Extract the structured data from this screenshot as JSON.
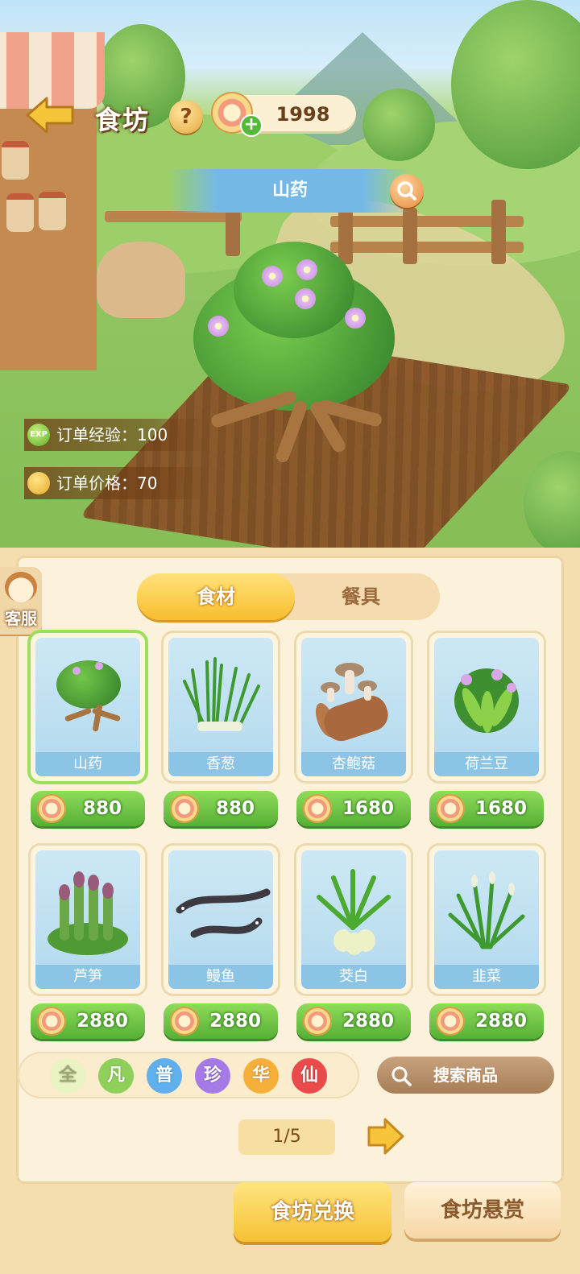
{
  "header": {
    "title": "食坊",
    "help_label": "?",
    "coins": "1998",
    "coin_plus": "+"
  },
  "selected_item": {
    "name": "山药",
    "order_exp_label": "订单经验：100",
    "order_price_label": "订单价格：70",
    "exp_icon_text": "EXP"
  },
  "service": {
    "label": "客服"
  },
  "tabs": [
    {
      "label": "食材",
      "active": true
    },
    {
      "label": "餐具",
      "active": false
    }
  ],
  "items": [
    {
      "name": "山药",
      "price": "880",
      "icon": "yam-plant"
    },
    {
      "name": "香葱",
      "price": "880",
      "icon": "scallion"
    },
    {
      "name": "杏鲍菇",
      "price": "1680",
      "icon": "king-oyster-mushroom"
    },
    {
      "name": "荷兰豆",
      "price": "1680",
      "icon": "snow-pea"
    },
    {
      "name": "芦笋",
      "price": "2880",
      "icon": "asparagus"
    },
    {
      "name": "鳗鱼",
      "price": "2880",
      "icon": "eel"
    },
    {
      "name": "茭白",
      "price": "2880",
      "icon": "water-bamboo"
    },
    {
      "name": "韭菜",
      "price": "2880",
      "icon": "chives"
    }
  ],
  "rarity_filters": [
    {
      "label": "全",
      "color": "#eaf3c2",
      "text_color": "#9aa870"
    },
    {
      "label": "凡",
      "color": "#8fd05a",
      "text_color": "#ffffff"
    },
    {
      "label": "普",
      "color": "#5fb0ec",
      "text_color": "#ffffff"
    },
    {
      "label": "珍",
      "color": "#a67ae6",
      "text_color": "#ffffff"
    },
    {
      "label": "华",
      "color": "#f6b03a",
      "text_color": "#ffffff"
    },
    {
      "label": "仙",
      "color": "#ea4a4a",
      "text_color": "#ffffff"
    }
  ],
  "search_goods_label": "搜索商品",
  "pagination": {
    "label": "1/5"
  },
  "bottom": {
    "exchange_label": "食坊兑换",
    "reward_label": "食坊悬赏"
  }
}
